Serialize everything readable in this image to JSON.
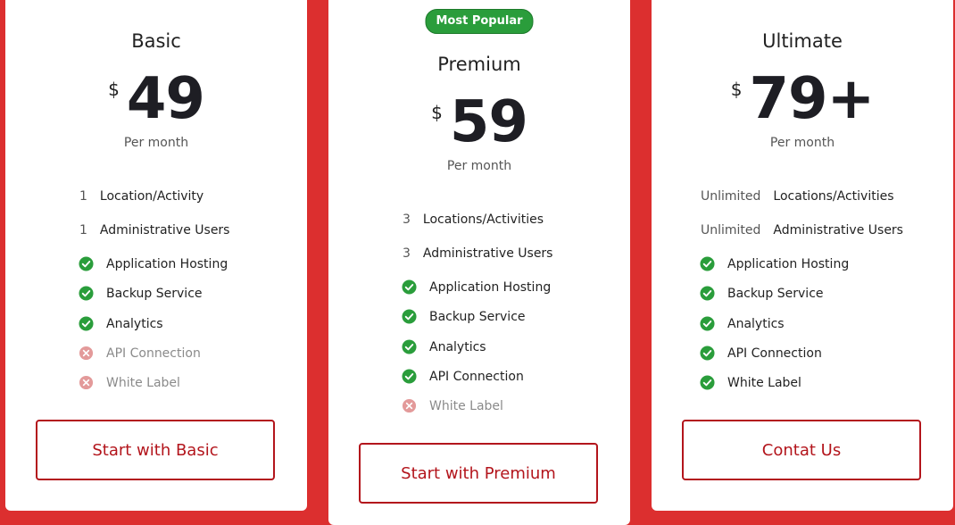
{
  "colors": {
    "background": "#dc2f2f",
    "card": "#ffffff",
    "accent": "#b3151c",
    "check": "#2a9d3b",
    "cross": "#e39a9a",
    "badge": "#2a9d3b"
  },
  "plans": [
    {
      "name": "Basic",
      "currency": "$",
      "price": "49",
      "period": "Per month",
      "quantities": [
        {
          "qty": "1",
          "label": "Location/Activity"
        },
        {
          "qty": "1",
          "label": "Administrative Users"
        }
      ],
      "features": [
        {
          "label": "Application Hosting",
          "included": true,
          "icon": "check-circle-icon"
        },
        {
          "label": "Backup Service",
          "included": true,
          "icon": "check-circle-icon"
        },
        {
          "label": "Analytics",
          "included": true,
          "icon": "check-circle-icon"
        },
        {
          "label": "API Connection",
          "included": false,
          "icon": "x-circle-icon"
        },
        {
          "label": "White Label",
          "included": false,
          "icon": "x-circle-icon"
        }
      ],
      "cta": "Start with Basic"
    },
    {
      "name": "Premium",
      "badge": "Most Popular",
      "currency": "$",
      "price": "59",
      "period": "Per month",
      "quantities": [
        {
          "qty": "3",
          "label": "Locations/Activities"
        },
        {
          "qty": "3",
          "label": "Administrative Users"
        }
      ],
      "features": [
        {
          "label": "Application Hosting",
          "included": true,
          "icon": "check-circle-icon"
        },
        {
          "label": "Backup Service",
          "included": true,
          "icon": "check-circle-icon"
        },
        {
          "label": "Analytics",
          "included": true,
          "icon": "check-circle-icon"
        },
        {
          "label": "API Connection",
          "included": true,
          "icon": "check-circle-icon"
        },
        {
          "label": "White Label",
          "included": false,
          "icon": "x-circle-icon"
        }
      ],
      "cta": "Start with Premium"
    },
    {
      "name": "Ultimate",
      "currency": "$",
      "price": "79+",
      "period": "Per month",
      "quantities": [
        {
          "qty": "Unlimited",
          "label": "Locations/Activities"
        },
        {
          "qty": "Unlimited",
          "label": "Administrative Users"
        }
      ],
      "features": [
        {
          "label": "Application Hosting",
          "included": true,
          "icon": "check-circle-icon"
        },
        {
          "label": "Backup Service",
          "included": true,
          "icon": "check-circle-icon"
        },
        {
          "label": "Analytics",
          "included": true,
          "icon": "check-circle-icon"
        },
        {
          "label": "API Connection",
          "included": true,
          "icon": "check-circle-icon"
        },
        {
          "label": "White Label",
          "included": true,
          "icon": "check-circle-icon"
        }
      ],
      "cta": "Contat Us"
    }
  ]
}
